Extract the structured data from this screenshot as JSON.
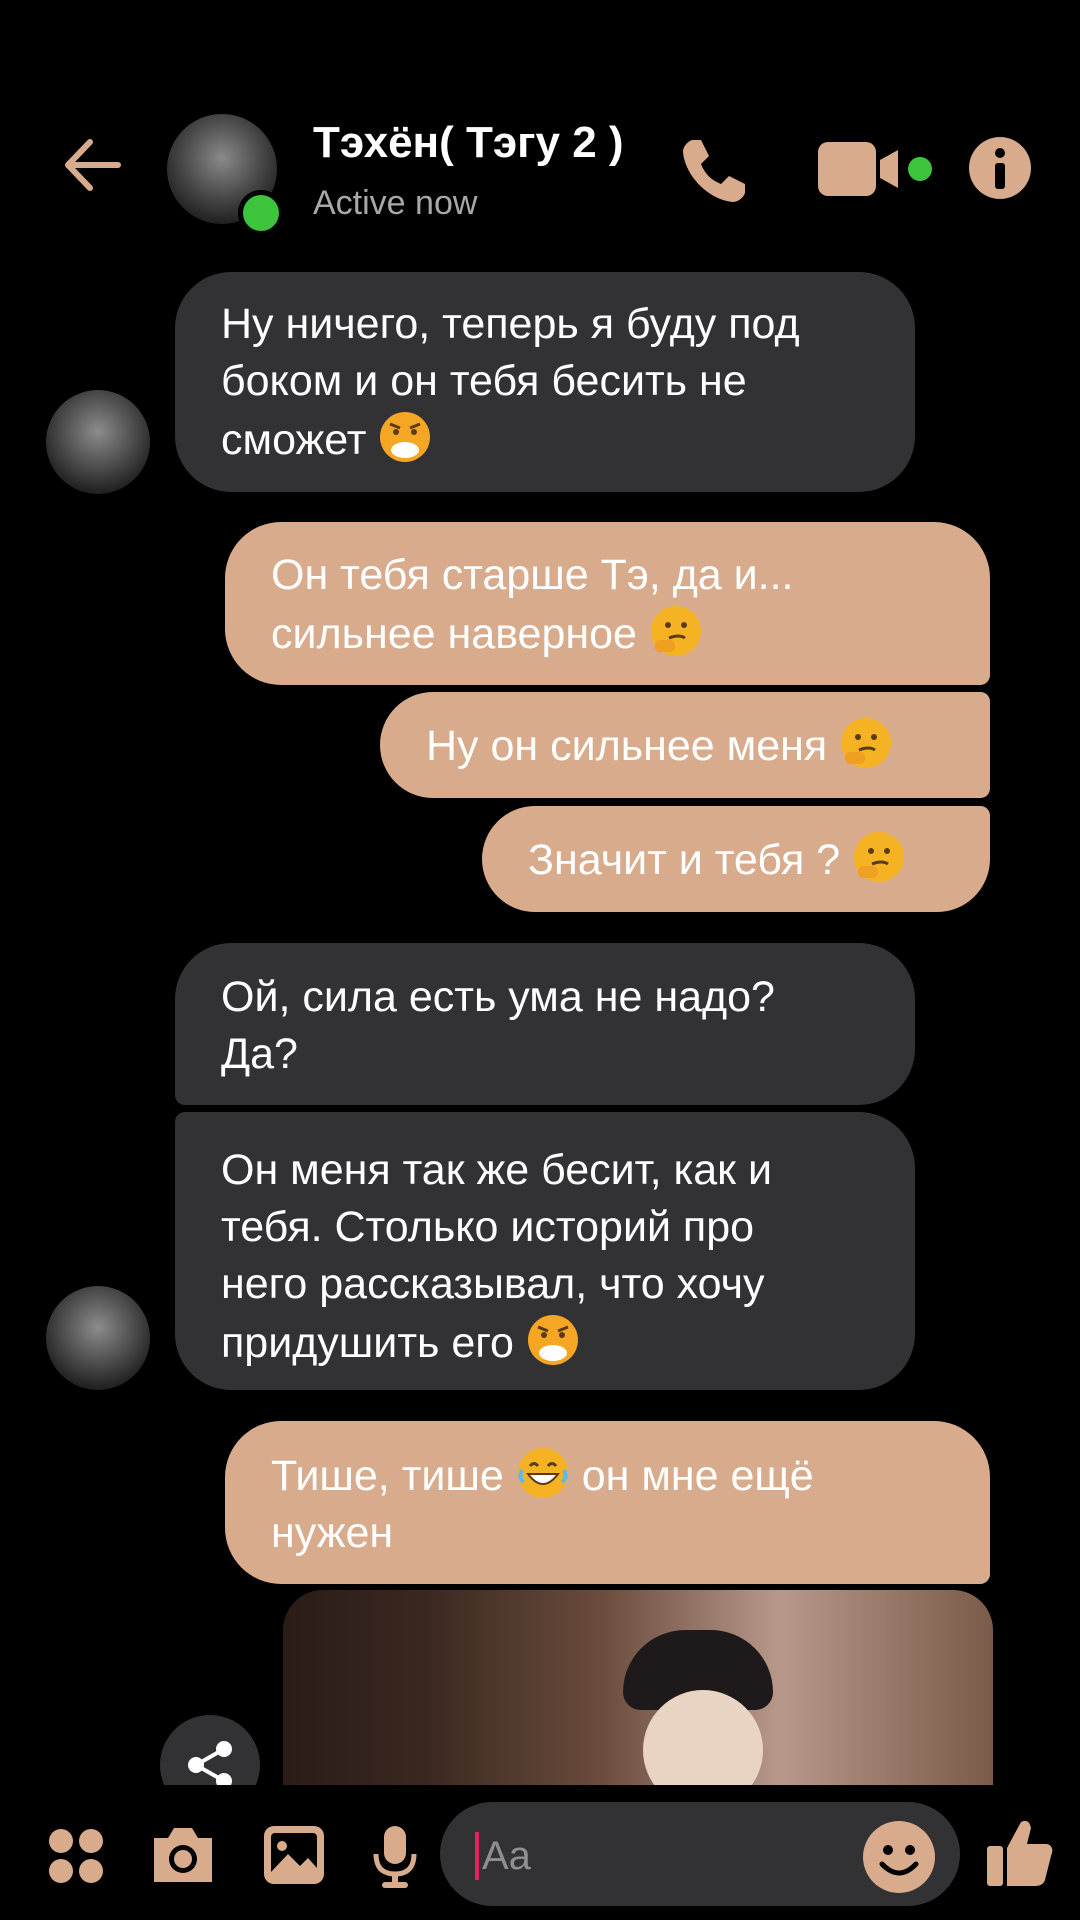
{
  "header": {
    "title": "Тэхён( Тэгу 2 )",
    "status": "Active now",
    "accent": "#d8ab8d",
    "online_color": "#3cc43c"
  },
  "messages": [
    {
      "side": "in",
      "lines": [
        "Ну ничего, теперь я буду под",
        "боком и он тебя бесить не",
        "сможет"
      ],
      "emoji": "angry-face-icon"
    },
    {
      "side": "out",
      "lines": [
        "Он тебя старше Тэ, да и...",
        "сильнее наверное"
      ],
      "emoji": "thinking-face-icon"
    },
    {
      "side": "out",
      "lines": [
        "Ну он сильнее меня"
      ],
      "emoji": "thinking-face-icon"
    },
    {
      "side": "out",
      "lines": [
        "Значит и тебя ?"
      ],
      "emoji": "thinking-face-icon"
    },
    {
      "side": "in",
      "lines": [
        "Ой, сила есть ума не надо?",
        "Да?"
      ]
    },
    {
      "side": "in",
      "lines": [
        "Он меня так же бесит, как и",
        "тебя. Столько историй про",
        "него рассказывал, что хочу",
        "придушить его"
      ],
      "emoji": "angry-face-icon"
    },
    {
      "side": "out",
      "lines": [
        "Тише, тише",
        "нужен"
      ],
      "inline_tail": "он мне ещё",
      "emoji": "grinning-face-icon"
    }
  ],
  "composer": {
    "placeholder": "Aa"
  },
  "icons": {
    "back": "arrow-left-icon",
    "call": "phone-icon",
    "video": "video-camera-icon",
    "info": "info-icon",
    "menu": "four-dots-icon",
    "camera": "camera-icon",
    "gallery": "image-icon",
    "mic": "microphone-icon",
    "emoji": "smiley-icon",
    "like": "thumbs-up-icon",
    "share": "share-icon"
  }
}
